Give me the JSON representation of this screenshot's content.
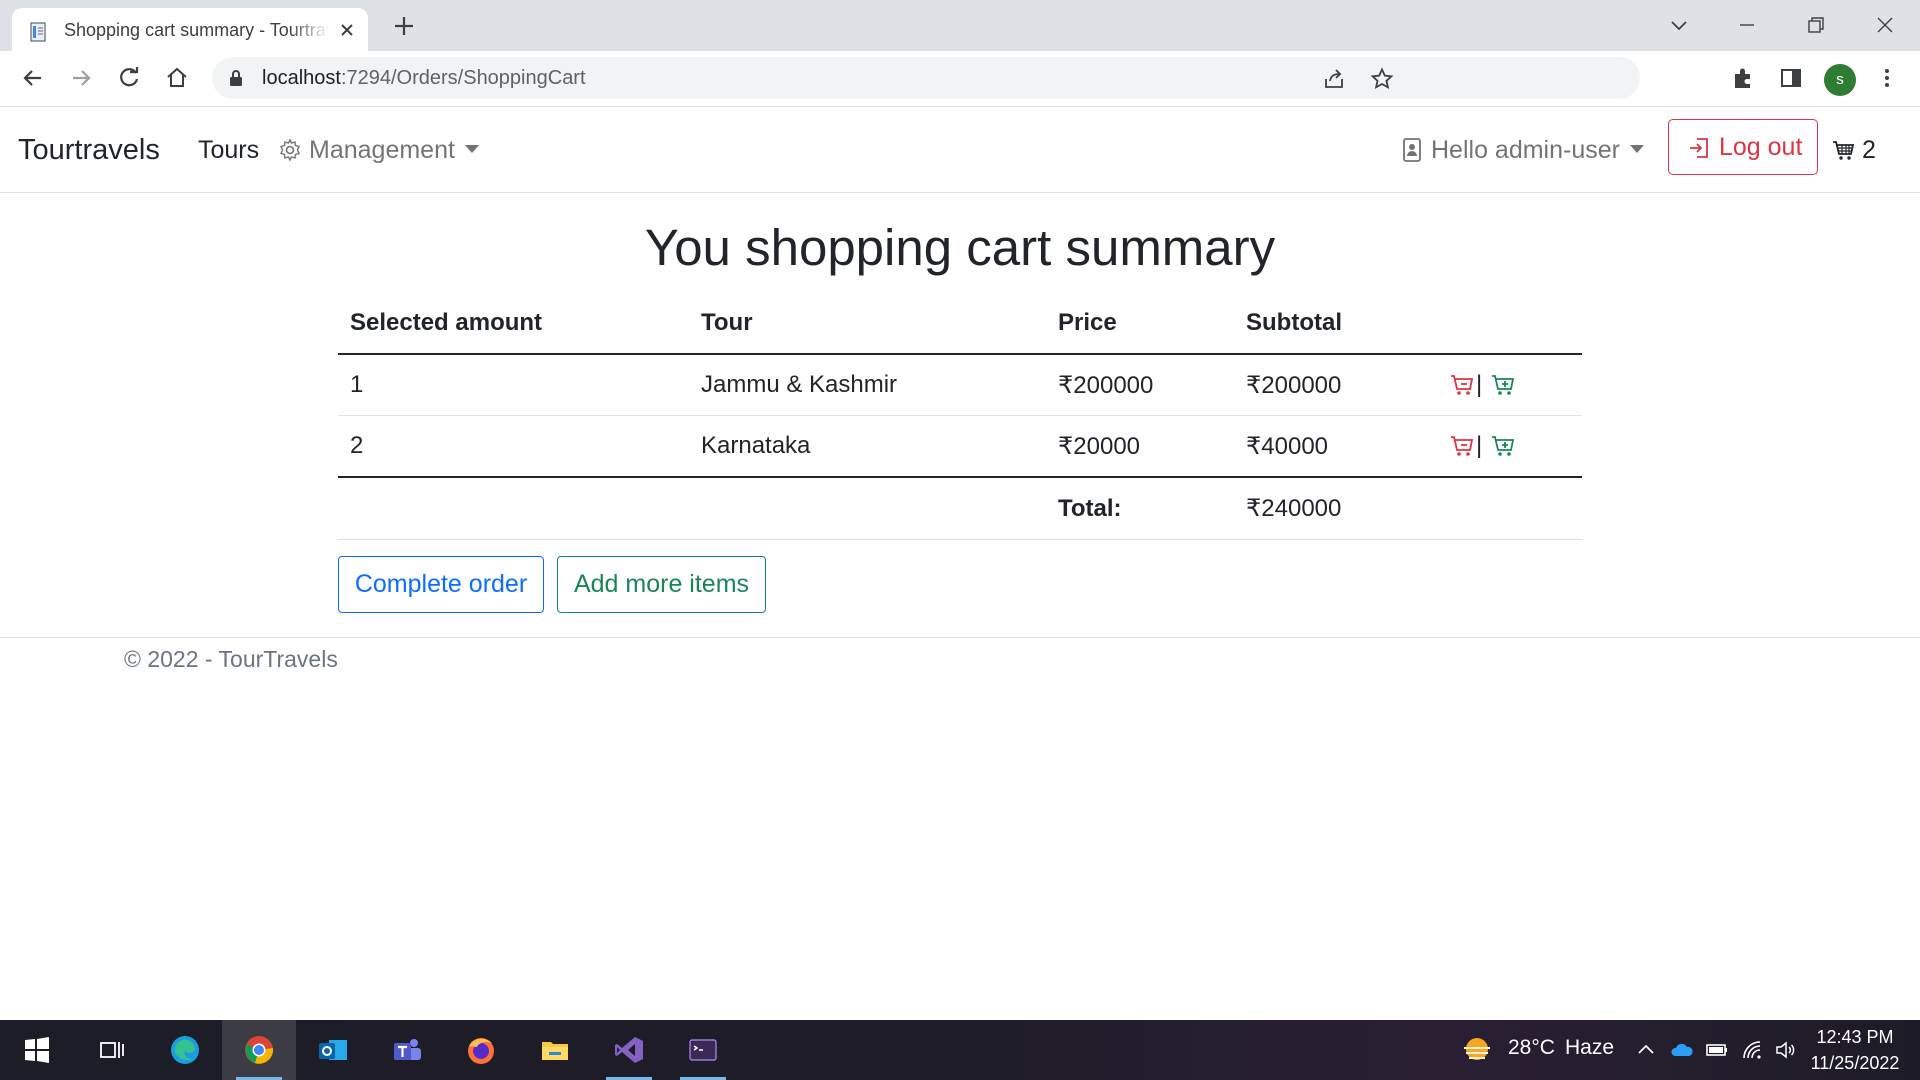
{
  "browser": {
    "tab_title": "Shopping cart summary - Tourtravels",
    "url_host": "localhost",
    "url_path": ":7294/Orders/ShoppingCart",
    "profile_initial": "s"
  },
  "navbar": {
    "brand": "Tourtravels",
    "tours": "Tours",
    "management": "Management",
    "greeting": "Hello admin-user",
    "logout": "Log out",
    "cart_count": "2"
  },
  "page": {
    "title": "You shopping cart summary"
  },
  "table": {
    "headers": [
      "Selected amount",
      "Tour",
      "Price",
      "Subtotal"
    ],
    "rows": [
      {
        "amount": "1",
        "tour": "Jammu & Kashmir",
        "price": "₹200000",
        "subtotal": "₹200000"
      },
      {
        "amount": "2",
        "tour": "Karnataka",
        "price": "₹20000",
        "subtotal": "₹40000"
      }
    ],
    "total_label": "Total:",
    "total_value": "₹240000",
    "separator": "|"
  },
  "buttons": {
    "complete": "Complete order",
    "add_more": "Add more items"
  },
  "footer": {
    "text": "© 2022 - TourTravels"
  },
  "taskbar": {
    "weather_temp": "28°C",
    "weather_desc": "Haze",
    "time": "12:43 PM",
    "date": "11/25/2022"
  },
  "colors": {
    "danger": "#dc3545",
    "primary": "#0d6efd",
    "success": "#198754"
  }
}
